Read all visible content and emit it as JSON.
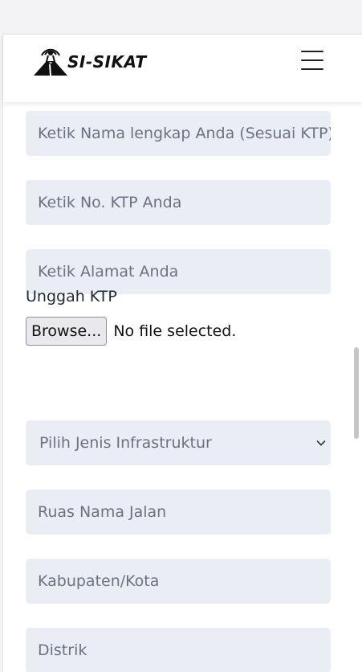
{
  "app": {
    "brand_name": "SI-SIKAT"
  },
  "icons": {
    "logo": "tower-road-logo-icon",
    "menu": "hamburger-menu-icon",
    "dropdown": "chevron-down-icon"
  },
  "form": {
    "nama_placeholder": "Ketik Nama lengkap Anda (Sesuai KTP)",
    "ktp_placeholder": "Ketik No. KTP Anda",
    "alamat_placeholder": "Ketik Alamat Anda",
    "upload_label": "Unggah KTP",
    "browse_label": "Browse...",
    "file_status": "No file selected.",
    "infrastruktur_selected": "Pilih Jenis Infrastruktur",
    "ruas_placeholder": "Ruas Nama Jalan",
    "kabupaten_placeholder": "Kabupaten/Kota",
    "distrik_placeholder": "Distrik"
  },
  "colors": {
    "field_bg": "#eaedf4",
    "placeholder_text": "#6b7280",
    "navbar_bg": "#ffffff",
    "page_bg": "#f3f3f5"
  }
}
